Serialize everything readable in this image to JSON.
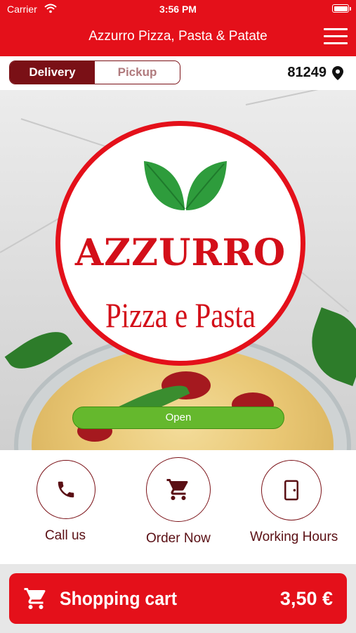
{
  "status_bar": {
    "carrier": "Carrier",
    "time": "3:56 PM"
  },
  "header": {
    "title": "Azzurro Pizza, Pasta & Patate",
    "menu_icon": "hamburger-menu-icon"
  },
  "order_mode": {
    "delivery_label": "Delivery",
    "pickup_label": "Pickup",
    "selected": "Delivery"
  },
  "location": {
    "zip": "81249",
    "icon": "location-pin-icon"
  },
  "hero": {
    "logo": {
      "brand": "AZZURRO",
      "subtitle": "Pizza e Pasta"
    },
    "status_label": "Open"
  },
  "actions": [
    {
      "label": "Call us",
      "icon": "phone-icon"
    },
    {
      "label": "Order Now",
      "icon": "cart-icon"
    },
    {
      "label": "Working Hours",
      "icon": "door-icon"
    }
  ],
  "cart": {
    "label": "Shopping cart",
    "total": "3,50 €",
    "icon": "cart-icon"
  },
  "colors": {
    "brand_red": "#e4101a",
    "dark_red": "#7a1016",
    "open_green": "#65b82d",
    "leaf_green": "#2e9c3c"
  }
}
